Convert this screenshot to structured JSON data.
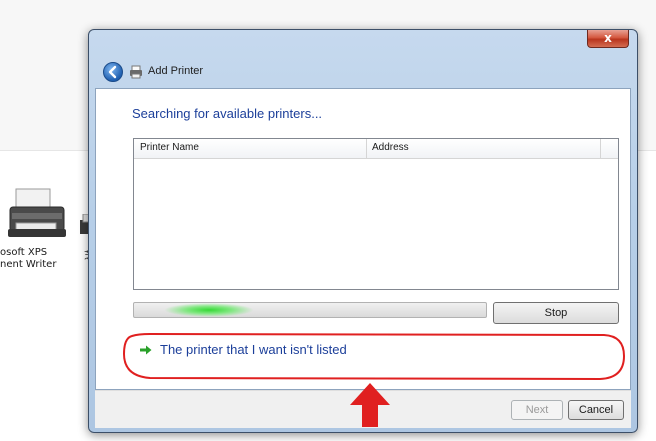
{
  "background": {
    "printer_label_line1": "osoft XPS",
    "printer_label_line2": "nent Writer",
    "fax_fragment": "芝"
  },
  "dialog": {
    "title": "Add Printer",
    "close_glyph": "x",
    "heading": "Searching for available printers...",
    "columns": [
      "Printer Name",
      "Address"
    ],
    "rows": [],
    "stop_label": "Stop",
    "link_text": "The printer that I want isn't listed",
    "next_label": "Next",
    "cancel_label": "Cancel",
    "next_enabled": false
  },
  "annotations": {
    "color": "#e02020",
    "shapes": [
      "oval-around-link",
      "up-arrow"
    ]
  },
  "colors": {
    "link": "#1c3f9a",
    "progress_glow": "#35d935",
    "close_button": "#c74a33"
  }
}
